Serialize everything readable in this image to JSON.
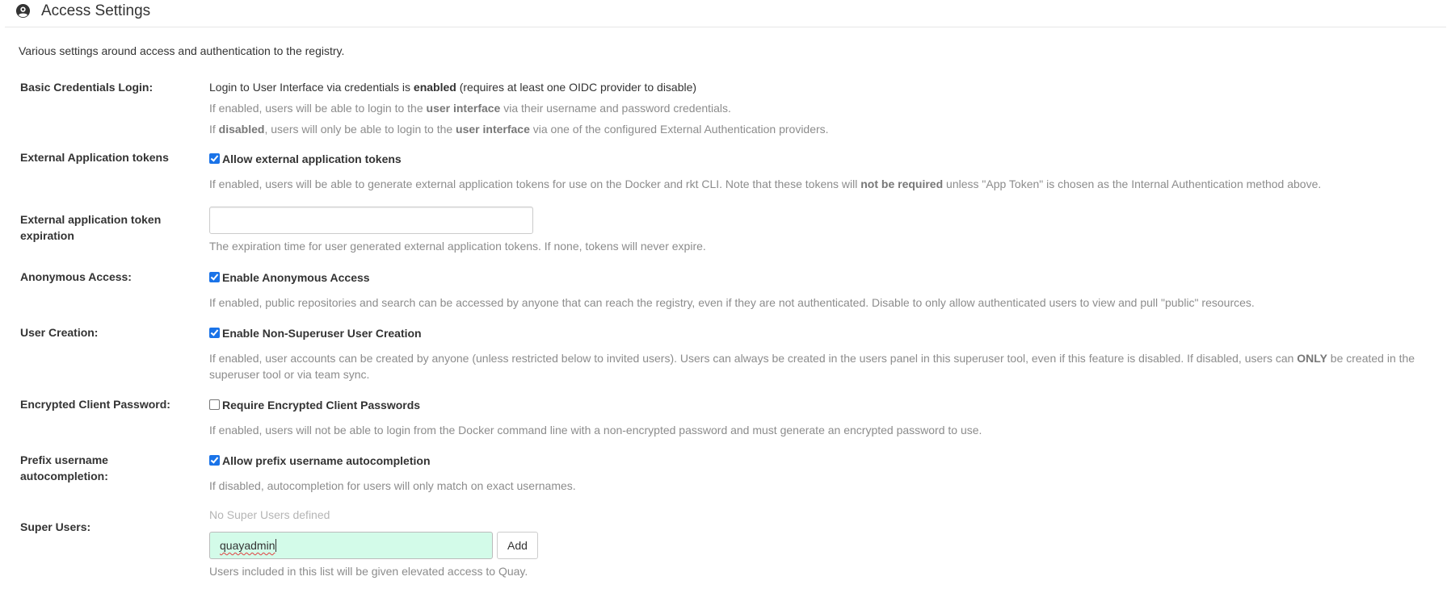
{
  "header": {
    "icon": "user-circle-icon",
    "title": "Access Settings"
  },
  "intro": "Various settings around access and authentication to the registry.",
  "basic_credentials": {
    "label": "Basic Credentials Login:",
    "status_prefix": "Login to User Interface via credentials is ",
    "status_value": "enabled",
    "status_suffix": " (requires at least one OIDC provider to disable)",
    "help1_a": "If enabled, users will be able to login to the ",
    "help1_b": "user interface",
    "help1_c": " via their username and password credentials.",
    "help2_a": "If ",
    "help2_b": "disabled",
    "help2_c": ", users will only be able to login to the ",
    "help2_d": "user interface",
    "help2_e": " via one of the configured External Authentication providers."
  },
  "external_tokens": {
    "label": "External Application tokens",
    "checkbox_label": "Allow external application tokens",
    "checked": true,
    "help_a": "If enabled, users will be able to generate external application tokens for use on the Docker and rkt CLI. Note that these tokens will ",
    "help_b": "not be required",
    "help_c": " unless \"App Token\" is chosen as the Internal Authentication method above."
  },
  "token_expiration": {
    "label": "External application token expiration",
    "value": "",
    "placeholder": "",
    "help": "The expiration time for user generated external application tokens. If none, tokens will never expire."
  },
  "anonymous_access": {
    "label": "Anonymous Access:",
    "checkbox_label": "Enable Anonymous Access",
    "checked": true,
    "help": "If enabled, public repositories and search can be accessed by anyone that can reach the registry, even if they are not authenticated. Disable to only allow authenticated users to view and pull \"public\" resources."
  },
  "user_creation": {
    "label": "User Creation:",
    "checkbox_label": "Enable Non-Superuser User Creation",
    "checked": true,
    "help_a": "If enabled, user accounts can be created by anyone (unless restricted below to invited users). Users can always be created in the users panel in this superuser tool, even if this feature is disabled. If disabled, users can ",
    "help_b": "ONLY",
    "help_c": " be created in the superuser tool or via team sync."
  },
  "encrypted_password": {
    "label": "Encrypted Client Password:",
    "checkbox_label": "Require Encrypted Client Passwords",
    "checked": false,
    "help": "If enabled, users will not be able to login from the Docker command line with a non-encrypted password and must generate an encrypted password to use."
  },
  "prefix_autocomplete": {
    "label": "Prefix username autocompletion:",
    "checkbox_label": "Allow prefix username autocompletion",
    "checked": true,
    "help": "If disabled, autocompletion for users will only match on exact usernames."
  },
  "super_users": {
    "label": "Super Users:",
    "empty_text": "No Super Users defined",
    "input_value": "quayadmin",
    "add_label": "Add",
    "help": "Users included in this list will be given elevated access to Quay."
  },
  "colors": {
    "checkbox_accent": "#1a73e8",
    "superuser_input_bg": "#d3fbe9",
    "help_text": "#8c8c8c"
  }
}
